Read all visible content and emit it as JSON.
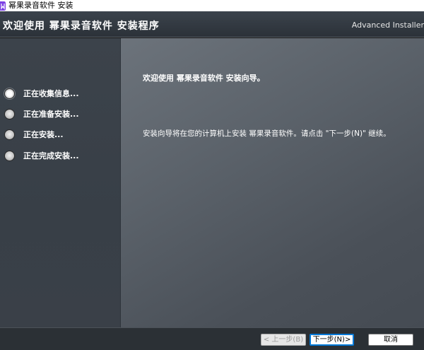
{
  "window": {
    "title": "幂果录音软件 安装",
    "icon": "app-logo-icon"
  },
  "header": {
    "title": "欢迎使用 幂果录音软件 安装程序",
    "brand": "Advanced Installer"
  },
  "steps": [
    {
      "label": "正在收集信息...",
      "active": true
    },
    {
      "label": "正在准备安装...",
      "active": false
    },
    {
      "label": "正在安装...",
      "active": false
    },
    {
      "label": "正在完成安装...",
      "active": false
    }
  ],
  "content": {
    "welcome": "欢迎使用 幂果录音软件 安装向导。",
    "description": "安装向导将在您的计算机上安装 幂果录音软件。请点击 \"下一步(N)\" 继续。"
  },
  "buttons": {
    "back": "< 上一步(B)",
    "next": "下一步(N)>",
    "cancel": "取消"
  },
  "colors": {
    "accent": "#0078d7"
  }
}
